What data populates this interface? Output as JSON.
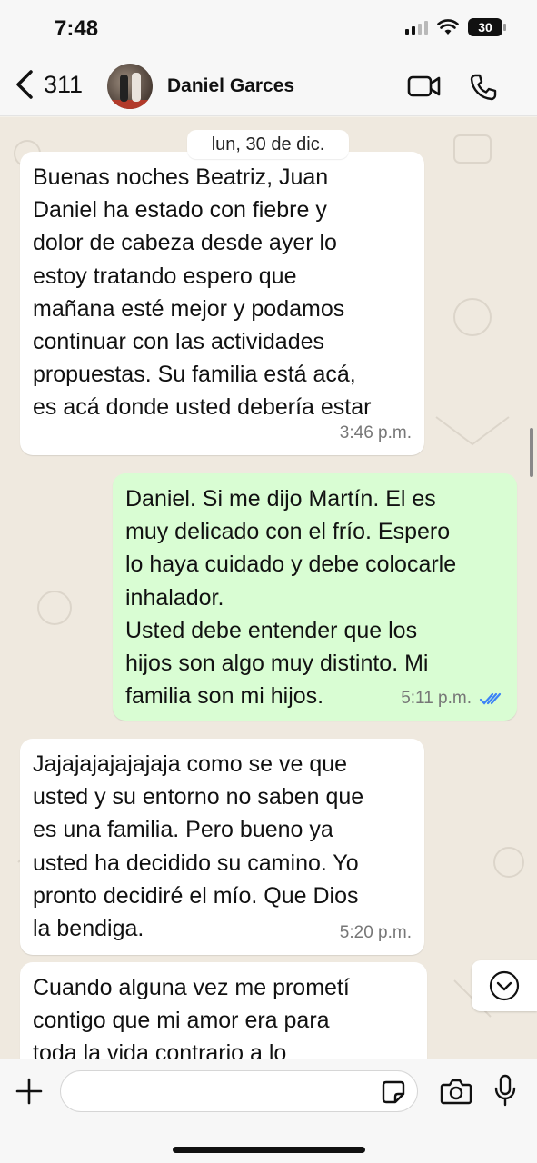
{
  "status": {
    "time": "7:48",
    "battery": "30"
  },
  "header": {
    "back_count": "311",
    "contact_name": "Daniel Garces"
  },
  "chat": {
    "date": "lun, 30 de dic.",
    "messages": [
      {
        "direction": "incoming",
        "lines": [
          "Buenas noches Beatriz, Juan",
          "Daniel ha estado con fiebre y",
          "dolor de cabeza desde ayer lo",
          "estoy tratando espero que",
          "mañana esté mejor y podamos",
          "continuar con las actividades",
          "propuestas. Su familia está acá,",
          "es acá donde usted debería estar"
        ],
        "time": "3:46 p.m."
      },
      {
        "direction": "outgoing",
        "lines": [
          "Daniel. Si me dijo Martín. El es",
          "muy delicado con el frío. Espero",
          "lo haya cuidado y debe colocarle",
          "inhalador.",
          "Usted debe entender que los",
          "hijos son algo muy distinto. Mi",
          "familia son mi hijos."
        ],
        "time": "5:11 p.m.",
        "read_color": "#3b82f6"
      },
      {
        "direction": "incoming",
        "lines": [
          "Jajajajajajajaja como se ve que",
          "usted y su entorno no saben que",
          "es una familia. Pero bueno ya",
          "usted ha decidido su camino. Yo",
          "pronto decidiré el mío. Que Dios",
          "la bendiga."
        ],
        "time": "5:20 p.m."
      },
      {
        "direction": "incoming",
        "lines": [
          "Cuando alguna vez me prometí",
          "contigo que mi amor era para",
          "toda la vida contrario a lo"
        ]
      }
    ]
  },
  "icons": {
    "back": "chevron-left-icon",
    "video": "video-camera-icon",
    "phone": "phone-icon",
    "scroll": "chevron-down-icon",
    "attach": "plus-icon",
    "sticker": "sticker-icon",
    "camera": "camera-icon",
    "mic": "microphone-icon"
  },
  "colors": {
    "outgoing_bubble": "#d9fdd3",
    "incoming_bubble": "#ffffff",
    "chat_background": "#efe9df"
  }
}
